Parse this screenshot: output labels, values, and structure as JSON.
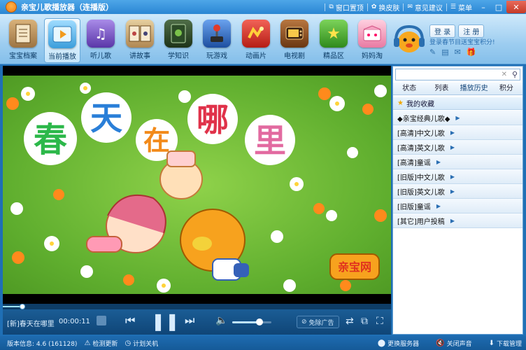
{
  "window": {
    "title": "亲宝儿歌播放器（连播版）",
    "menu": [
      {
        "icon": "restore-icon",
        "label": "窗口置顶"
      },
      {
        "icon": "skin-icon",
        "label": "换皮肤"
      },
      {
        "icon": "feedback-icon",
        "label": "意见建议"
      },
      {
        "icon": "menu-icon",
        "label": "菜单"
      }
    ]
  },
  "toolbar": {
    "items": [
      {
        "label": "宝宝档案",
        "icon": "baby-profile-icon",
        "active": false,
        "color": "#b08a55"
      },
      {
        "label": "当前播放",
        "icon": "now-playing-icon",
        "active": true,
        "color": "#63b7e6"
      },
      {
        "label": "听儿歌",
        "icon": "music-icon",
        "active": false,
        "color": "#7b55c7"
      },
      {
        "label": "讲故事",
        "icon": "story-book-icon",
        "active": false,
        "color": "#c8a46a"
      },
      {
        "label": "学知识",
        "icon": "knowledge-icon",
        "active": false,
        "color": "#2e4a2a"
      },
      {
        "label": "玩游戏",
        "icon": "joystick-icon",
        "active": false,
        "color": "#2a62b8"
      },
      {
        "label": "动画片",
        "icon": "animation-icon",
        "active": false,
        "color": "#d8342b"
      },
      {
        "label": "电视剧",
        "icon": "tv-icon",
        "active": false,
        "color": "#8a4b1a"
      },
      {
        "label": "精品区",
        "icon": "star-icon",
        "active": false,
        "color": "#4aa530"
      },
      {
        "label": "妈妈淘",
        "icon": "shop-icon",
        "active": false,
        "color": "#f28bb0"
      }
    ],
    "login_label": "登 录",
    "register_label": "注 册",
    "promo": "登录春节目送宝宝积分!",
    "icons": [
      "edit-icon",
      "card-icon",
      "mail-icon",
      "gift-icon"
    ]
  },
  "video": {
    "title_text": "春天在哪里",
    "title_chars": [
      "春",
      "天",
      "在",
      "哪",
      "里"
    ],
    "logo_text": "亲宝网"
  },
  "player": {
    "now_playing": "[新]春天在哪里",
    "time": "00:00:11",
    "progress": 0.05,
    "volume": 0.7,
    "no_ad_label": "免除广告"
  },
  "sidebar": {
    "search_placeholder": "",
    "tabs": [
      "状态",
      "列表",
      "播放历史",
      "积分"
    ],
    "active_tab": 2,
    "favorites_label": "我的收藏",
    "playlists": [
      "◆亲宝经典儿歌◆",
      "[高清]中文儿歌",
      "[高清]英文儿歌",
      "[高清]童谣",
      "[旧版]中文儿歌",
      "[旧版]英文儿歌",
      "[旧版]童谣",
      "[其它]用户投稿"
    ]
  },
  "status": {
    "version": "版本信息: 4.6 (161128)",
    "check_update": "检测更新",
    "shutdown": "计划关机",
    "change_server": "更换服务器",
    "mute": "关闭声音",
    "download": "下载管理"
  }
}
